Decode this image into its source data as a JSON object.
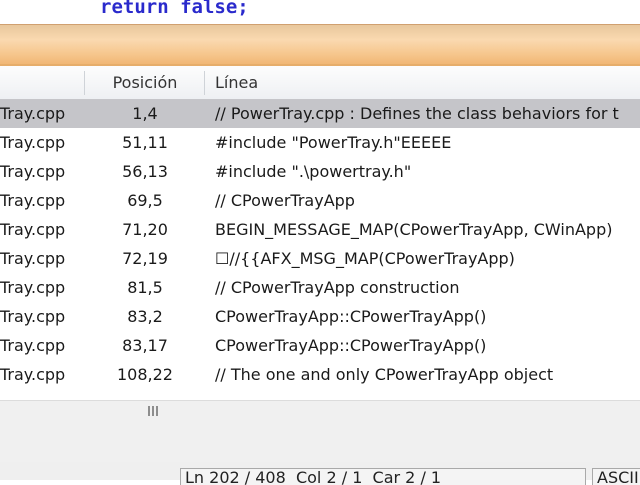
{
  "editor": {
    "code_line": "return false;"
  },
  "results": {
    "columns": {
      "file": "",
      "position": "Posición",
      "line": "Línea"
    },
    "rows": [
      {
        "file": "Tray.cpp",
        "position": "1,4",
        "line": "// PowerTray.cpp : Defines the class behaviors for t",
        "selected": true
      },
      {
        "file": "Tray.cpp",
        "position": "51,11",
        "line": "#include \"PowerTray.h\"EEEEE"
      },
      {
        "file": "Tray.cpp",
        "position": "56,13",
        "line": "#include \".\\powertray.h\""
      },
      {
        "file": "Tray.cpp",
        "position": "69,5",
        "line": "// CPowerTrayApp"
      },
      {
        "file": "Tray.cpp",
        "position": "71,20",
        "line": "BEGIN_MESSAGE_MAP(CPowerTrayApp, CWinApp)"
      },
      {
        "file": "Tray.cpp",
        "position": "72,19",
        "line": "☐//{{AFX_MSG_MAP(CPowerTrayApp)"
      },
      {
        "file": "Tray.cpp",
        "position": "81,5",
        "line": "// CPowerTrayApp construction"
      },
      {
        "file": "Tray.cpp",
        "position": "83,2",
        "line": "CPowerTrayApp::CPowerTrayApp()"
      },
      {
        "file": "Tray.cpp",
        "position": "83,17",
        "line": "CPowerTrayApp::CPowerTrayApp()"
      },
      {
        "file": "Tray.cpp",
        "position": "108,22",
        "line": "// The one and only CPowerTrayApp object"
      }
    ]
  },
  "statusbar": {
    "cursor": "Ln 202 / 408  Col 2 / 1  Car 2 / 1",
    "encoding": "ASCII"
  }
}
